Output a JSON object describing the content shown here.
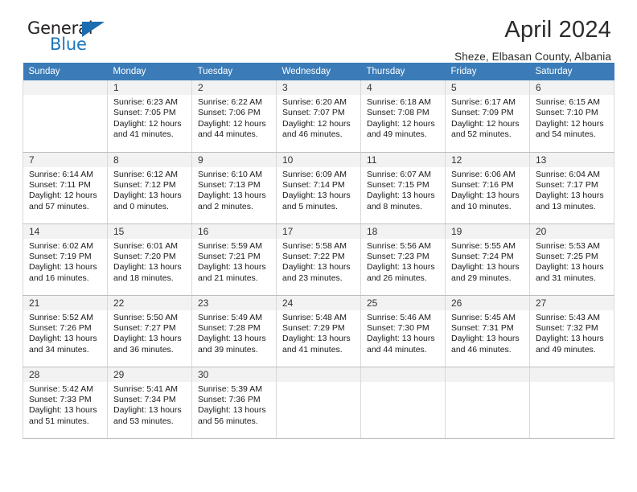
{
  "brand": {
    "name_top": "General",
    "name_bottom": "Blue",
    "triangle_icon": "triangle-icon",
    "accent_color": "#1b75bc"
  },
  "header": {
    "title": "April 2024",
    "location": "Sheze, Elbasan County, Albania"
  },
  "theme": {
    "header_row_bg": "#3b7cb8",
    "header_row_text": "#ffffff",
    "daynum_bg": "#f2f2f2",
    "cell_border": "#d9d9d9",
    "week_border": "#bfbfbf"
  },
  "calendar": {
    "weekday_headers": [
      "Sunday",
      "Monday",
      "Tuesday",
      "Wednesday",
      "Thursday",
      "Friday",
      "Saturday"
    ],
    "labels": {
      "sunrise_prefix": "Sunrise:",
      "sunset_prefix": "Sunset:",
      "daylight_prefix": "Daylight:"
    },
    "weeks": [
      {
        "days": [
          {
            "num": "",
            "sunrise": "",
            "sunset": "",
            "daylight": "",
            "empty": true
          },
          {
            "num": "1",
            "sunrise": "Sunrise: 6:23 AM",
            "sunset": "Sunset: 7:05 PM",
            "daylight": "Daylight: 12 hours and 41 minutes."
          },
          {
            "num": "2",
            "sunrise": "Sunrise: 6:22 AM",
            "sunset": "Sunset: 7:06 PM",
            "daylight": "Daylight: 12 hours and 44 minutes."
          },
          {
            "num": "3",
            "sunrise": "Sunrise: 6:20 AM",
            "sunset": "Sunset: 7:07 PM",
            "daylight": "Daylight: 12 hours and 46 minutes."
          },
          {
            "num": "4",
            "sunrise": "Sunrise: 6:18 AM",
            "sunset": "Sunset: 7:08 PM",
            "daylight": "Daylight: 12 hours and 49 minutes."
          },
          {
            "num": "5",
            "sunrise": "Sunrise: 6:17 AM",
            "sunset": "Sunset: 7:09 PM",
            "daylight": "Daylight: 12 hours and 52 minutes."
          },
          {
            "num": "6",
            "sunrise": "Sunrise: 6:15 AM",
            "sunset": "Sunset: 7:10 PM",
            "daylight": "Daylight: 12 hours and 54 minutes."
          }
        ]
      },
      {
        "days": [
          {
            "num": "7",
            "sunrise": "Sunrise: 6:14 AM",
            "sunset": "Sunset: 7:11 PM",
            "daylight": "Daylight: 12 hours and 57 minutes."
          },
          {
            "num": "8",
            "sunrise": "Sunrise: 6:12 AM",
            "sunset": "Sunset: 7:12 PM",
            "daylight": "Daylight: 13 hours and 0 minutes."
          },
          {
            "num": "9",
            "sunrise": "Sunrise: 6:10 AM",
            "sunset": "Sunset: 7:13 PM",
            "daylight": "Daylight: 13 hours and 2 minutes."
          },
          {
            "num": "10",
            "sunrise": "Sunrise: 6:09 AM",
            "sunset": "Sunset: 7:14 PM",
            "daylight": "Daylight: 13 hours and 5 minutes."
          },
          {
            "num": "11",
            "sunrise": "Sunrise: 6:07 AM",
            "sunset": "Sunset: 7:15 PM",
            "daylight": "Daylight: 13 hours and 8 minutes."
          },
          {
            "num": "12",
            "sunrise": "Sunrise: 6:06 AM",
            "sunset": "Sunset: 7:16 PM",
            "daylight": "Daylight: 13 hours and 10 minutes."
          },
          {
            "num": "13",
            "sunrise": "Sunrise: 6:04 AM",
            "sunset": "Sunset: 7:17 PM",
            "daylight": "Daylight: 13 hours and 13 minutes."
          }
        ]
      },
      {
        "days": [
          {
            "num": "14",
            "sunrise": "Sunrise: 6:02 AM",
            "sunset": "Sunset: 7:19 PM",
            "daylight": "Daylight: 13 hours and 16 minutes."
          },
          {
            "num": "15",
            "sunrise": "Sunrise: 6:01 AM",
            "sunset": "Sunset: 7:20 PM",
            "daylight": "Daylight: 13 hours and 18 minutes."
          },
          {
            "num": "16",
            "sunrise": "Sunrise: 5:59 AM",
            "sunset": "Sunset: 7:21 PM",
            "daylight": "Daylight: 13 hours and 21 minutes."
          },
          {
            "num": "17",
            "sunrise": "Sunrise: 5:58 AM",
            "sunset": "Sunset: 7:22 PM",
            "daylight": "Daylight: 13 hours and 23 minutes."
          },
          {
            "num": "18",
            "sunrise": "Sunrise: 5:56 AM",
            "sunset": "Sunset: 7:23 PM",
            "daylight": "Daylight: 13 hours and 26 minutes."
          },
          {
            "num": "19",
            "sunrise": "Sunrise: 5:55 AM",
            "sunset": "Sunset: 7:24 PM",
            "daylight": "Daylight: 13 hours and 29 minutes."
          },
          {
            "num": "20",
            "sunrise": "Sunrise: 5:53 AM",
            "sunset": "Sunset: 7:25 PM",
            "daylight": "Daylight: 13 hours and 31 minutes."
          }
        ]
      },
      {
        "days": [
          {
            "num": "21",
            "sunrise": "Sunrise: 5:52 AM",
            "sunset": "Sunset: 7:26 PM",
            "daylight": "Daylight: 13 hours and 34 minutes."
          },
          {
            "num": "22",
            "sunrise": "Sunrise: 5:50 AM",
            "sunset": "Sunset: 7:27 PM",
            "daylight": "Daylight: 13 hours and 36 minutes."
          },
          {
            "num": "23",
            "sunrise": "Sunrise: 5:49 AM",
            "sunset": "Sunset: 7:28 PM",
            "daylight": "Daylight: 13 hours and 39 minutes."
          },
          {
            "num": "24",
            "sunrise": "Sunrise: 5:48 AM",
            "sunset": "Sunset: 7:29 PM",
            "daylight": "Daylight: 13 hours and 41 minutes."
          },
          {
            "num": "25",
            "sunrise": "Sunrise: 5:46 AM",
            "sunset": "Sunset: 7:30 PM",
            "daylight": "Daylight: 13 hours and 44 minutes."
          },
          {
            "num": "26",
            "sunrise": "Sunrise: 5:45 AM",
            "sunset": "Sunset: 7:31 PM",
            "daylight": "Daylight: 13 hours and 46 minutes."
          },
          {
            "num": "27",
            "sunrise": "Sunrise: 5:43 AM",
            "sunset": "Sunset: 7:32 PM",
            "daylight": "Daylight: 13 hours and 49 minutes."
          }
        ]
      },
      {
        "days": [
          {
            "num": "28",
            "sunrise": "Sunrise: 5:42 AM",
            "sunset": "Sunset: 7:33 PM",
            "daylight": "Daylight: 13 hours and 51 minutes."
          },
          {
            "num": "29",
            "sunrise": "Sunrise: 5:41 AM",
            "sunset": "Sunset: 7:34 PM",
            "daylight": "Daylight: 13 hours and 53 minutes."
          },
          {
            "num": "30",
            "sunrise": "Sunrise: 5:39 AM",
            "sunset": "Sunset: 7:36 PM",
            "daylight": "Daylight: 13 hours and 56 minutes."
          },
          {
            "num": "",
            "sunrise": "",
            "sunset": "",
            "daylight": "",
            "blank": true
          },
          {
            "num": "",
            "sunrise": "",
            "sunset": "",
            "daylight": "",
            "blank": true
          },
          {
            "num": "",
            "sunrise": "",
            "sunset": "",
            "daylight": "",
            "blank": true
          },
          {
            "num": "",
            "sunrise": "",
            "sunset": "",
            "daylight": "",
            "blank": true
          }
        ]
      }
    ]
  }
}
